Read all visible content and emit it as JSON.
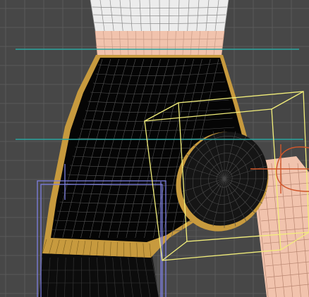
{
  "viewport": {
    "kind": "3d-modeling-viewport",
    "view": "wireframe-over-shaded",
    "background_color": "#474747",
    "grid_color": "#5a5a5a"
  },
  "model": {
    "top_garment_color": "#ececec",
    "skin_color": "#f1c3ad",
    "shorts_color": "#050505",
    "trim_color": "#c79a3e",
    "leg_color": "#0c0c0c",
    "wire_color_dark": "#555555",
    "wire_color_light": "#444444"
  },
  "helpers": {
    "teal_guide_color": "#2aa6a0",
    "selection_box_color": "#f2ee7a",
    "blue_lattice_color": "#7d7fe0",
    "orange_gizmo_color": "#d0562a"
  }
}
